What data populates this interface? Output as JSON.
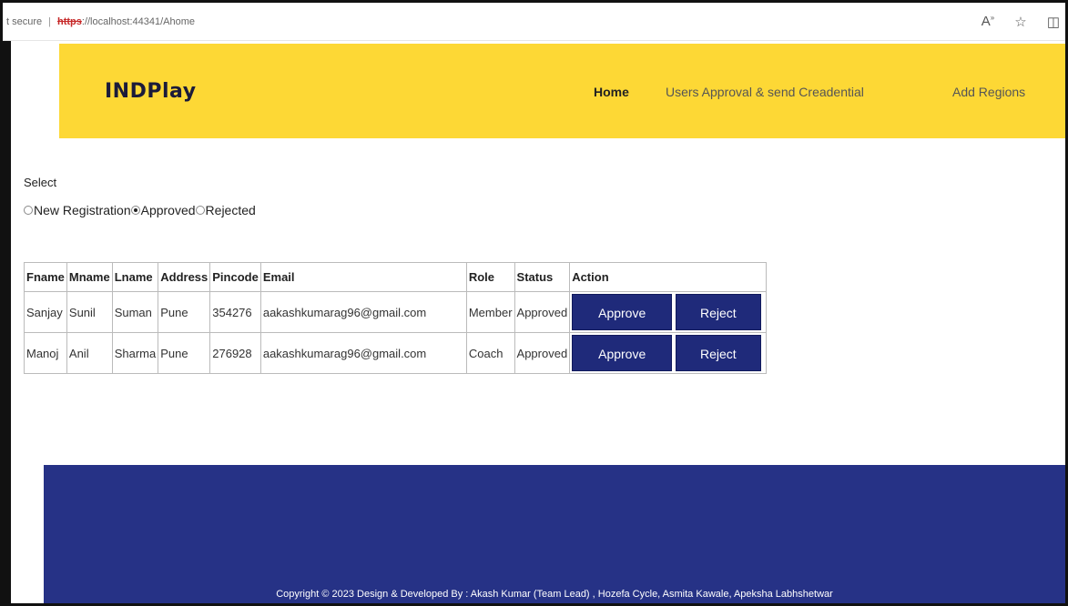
{
  "browser": {
    "secure_label": "t secure",
    "url_protocol": "https",
    "url_rest": "://localhost:44341/Ahome",
    "icons": [
      "read-aloud-icon",
      "favorite-star-icon",
      "split-screen-icon"
    ]
  },
  "header": {
    "brand": "INDPlay",
    "nav": {
      "home": "Home",
      "users_approval": "Users Approval & send Creadential",
      "add_regions": "Add Regions"
    },
    "color": "#fdd835"
  },
  "filter": {
    "label": "Select",
    "options": [
      {
        "label": "New Registration",
        "checked": false
      },
      {
        "label": "Approved",
        "checked": true
      },
      {
        "label": "Rejected",
        "checked": false
      }
    ]
  },
  "table": {
    "headers": [
      "Fname",
      "Mname",
      "Lname",
      "Address",
      "Pincode",
      "Email",
      "Role",
      "Status",
      "Action"
    ],
    "rows": [
      {
        "fname": "Sanjay",
        "mname": "Sunil",
        "lname": "Suman",
        "address": "Pune",
        "pincode": "354276",
        "email": "aakashkumarag96@gmail.com",
        "role": "Member",
        "status": "Approved",
        "approve": "Approve",
        "reject": "Reject"
      },
      {
        "fname": "Manoj",
        "mname": "Anil",
        "lname": "Sharma",
        "address": "Pune",
        "pincode": "276928",
        "email": "aakashkumarag96@gmail.com",
        "role": "Coach",
        "status": "Approved",
        "approve": "Approve",
        "reject": "Reject"
      }
    ]
  },
  "footer": {
    "copyright": "Copyright © 2023 Design & Developed By : Akash Kumar (Team Lead) , Hozefa Cycle, Asmita Kawale, Apeksha Labhshetwar",
    "color": "#263286"
  },
  "colors": {
    "button": "#1f2a7a",
    "button_text": "#ffffff"
  }
}
